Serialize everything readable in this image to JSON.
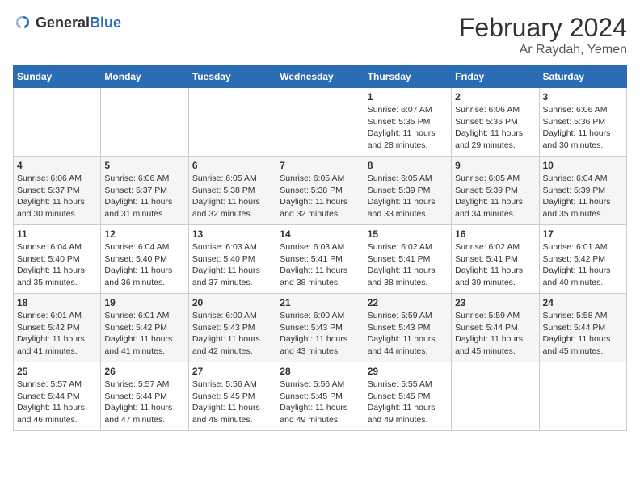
{
  "logo": {
    "general": "General",
    "blue": "Blue"
  },
  "title": "February 2024",
  "subtitle": "Ar Raydah, Yemen",
  "days_of_week": [
    "Sunday",
    "Monday",
    "Tuesday",
    "Wednesday",
    "Thursday",
    "Friday",
    "Saturday"
  ],
  "weeks": [
    [
      {
        "day": "",
        "sunrise": "",
        "sunset": "",
        "daylight": ""
      },
      {
        "day": "",
        "sunrise": "",
        "sunset": "",
        "daylight": ""
      },
      {
        "day": "",
        "sunrise": "",
        "sunset": "",
        "daylight": ""
      },
      {
        "day": "",
        "sunrise": "",
        "sunset": "",
        "daylight": ""
      },
      {
        "day": "1",
        "sunrise": "Sunrise: 6:07 AM",
        "sunset": "Sunset: 5:35 PM",
        "daylight": "Daylight: 11 hours and 28 minutes."
      },
      {
        "day": "2",
        "sunrise": "Sunrise: 6:06 AM",
        "sunset": "Sunset: 5:36 PM",
        "daylight": "Daylight: 11 hours and 29 minutes."
      },
      {
        "day": "3",
        "sunrise": "Sunrise: 6:06 AM",
        "sunset": "Sunset: 5:36 PM",
        "daylight": "Daylight: 11 hours and 30 minutes."
      }
    ],
    [
      {
        "day": "4",
        "sunrise": "Sunrise: 6:06 AM",
        "sunset": "Sunset: 5:37 PM",
        "daylight": "Daylight: 11 hours and 30 minutes."
      },
      {
        "day": "5",
        "sunrise": "Sunrise: 6:06 AM",
        "sunset": "Sunset: 5:37 PM",
        "daylight": "Daylight: 11 hours and 31 minutes."
      },
      {
        "day": "6",
        "sunrise": "Sunrise: 6:05 AM",
        "sunset": "Sunset: 5:38 PM",
        "daylight": "Daylight: 11 hours and 32 minutes."
      },
      {
        "day": "7",
        "sunrise": "Sunrise: 6:05 AM",
        "sunset": "Sunset: 5:38 PM",
        "daylight": "Daylight: 11 hours and 32 minutes."
      },
      {
        "day": "8",
        "sunrise": "Sunrise: 6:05 AM",
        "sunset": "Sunset: 5:39 PM",
        "daylight": "Daylight: 11 hours and 33 minutes."
      },
      {
        "day": "9",
        "sunrise": "Sunrise: 6:05 AM",
        "sunset": "Sunset: 5:39 PM",
        "daylight": "Daylight: 11 hours and 34 minutes."
      },
      {
        "day": "10",
        "sunrise": "Sunrise: 6:04 AM",
        "sunset": "Sunset: 5:39 PM",
        "daylight": "Daylight: 11 hours and 35 minutes."
      }
    ],
    [
      {
        "day": "11",
        "sunrise": "Sunrise: 6:04 AM",
        "sunset": "Sunset: 5:40 PM",
        "daylight": "Daylight: 11 hours and 35 minutes."
      },
      {
        "day": "12",
        "sunrise": "Sunrise: 6:04 AM",
        "sunset": "Sunset: 5:40 PM",
        "daylight": "Daylight: 11 hours and 36 minutes."
      },
      {
        "day": "13",
        "sunrise": "Sunrise: 6:03 AM",
        "sunset": "Sunset: 5:40 PM",
        "daylight": "Daylight: 11 hours and 37 minutes."
      },
      {
        "day": "14",
        "sunrise": "Sunrise: 6:03 AM",
        "sunset": "Sunset: 5:41 PM",
        "daylight": "Daylight: 11 hours and 38 minutes."
      },
      {
        "day": "15",
        "sunrise": "Sunrise: 6:02 AM",
        "sunset": "Sunset: 5:41 PM",
        "daylight": "Daylight: 11 hours and 38 minutes."
      },
      {
        "day": "16",
        "sunrise": "Sunrise: 6:02 AM",
        "sunset": "Sunset: 5:41 PM",
        "daylight": "Daylight: 11 hours and 39 minutes."
      },
      {
        "day": "17",
        "sunrise": "Sunrise: 6:01 AM",
        "sunset": "Sunset: 5:42 PM",
        "daylight": "Daylight: 11 hours and 40 minutes."
      }
    ],
    [
      {
        "day": "18",
        "sunrise": "Sunrise: 6:01 AM",
        "sunset": "Sunset: 5:42 PM",
        "daylight": "Daylight: 11 hours and 41 minutes."
      },
      {
        "day": "19",
        "sunrise": "Sunrise: 6:01 AM",
        "sunset": "Sunset: 5:42 PM",
        "daylight": "Daylight: 11 hours and 41 minutes."
      },
      {
        "day": "20",
        "sunrise": "Sunrise: 6:00 AM",
        "sunset": "Sunset: 5:43 PM",
        "daylight": "Daylight: 11 hours and 42 minutes."
      },
      {
        "day": "21",
        "sunrise": "Sunrise: 6:00 AM",
        "sunset": "Sunset: 5:43 PM",
        "daylight": "Daylight: 11 hours and 43 minutes."
      },
      {
        "day": "22",
        "sunrise": "Sunrise: 5:59 AM",
        "sunset": "Sunset: 5:43 PM",
        "daylight": "Daylight: 11 hours and 44 minutes."
      },
      {
        "day": "23",
        "sunrise": "Sunrise: 5:59 AM",
        "sunset": "Sunset: 5:44 PM",
        "daylight": "Daylight: 11 hours and 45 minutes."
      },
      {
        "day": "24",
        "sunrise": "Sunrise: 5:58 AM",
        "sunset": "Sunset: 5:44 PM",
        "daylight": "Daylight: 11 hours and 45 minutes."
      }
    ],
    [
      {
        "day": "25",
        "sunrise": "Sunrise: 5:57 AM",
        "sunset": "Sunset: 5:44 PM",
        "daylight": "Daylight: 11 hours and 46 minutes."
      },
      {
        "day": "26",
        "sunrise": "Sunrise: 5:57 AM",
        "sunset": "Sunset: 5:44 PM",
        "daylight": "Daylight: 11 hours and 47 minutes."
      },
      {
        "day": "27",
        "sunrise": "Sunrise: 5:56 AM",
        "sunset": "Sunset: 5:45 PM",
        "daylight": "Daylight: 11 hours and 48 minutes."
      },
      {
        "day": "28",
        "sunrise": "Sunrise: 5:56 AM",
        "sunset": "Sunset: 5:45 PM",
        "daylight": "Daylight: 11 hours and 49 minutes."
      },
      {
        "day": "29",
        "sunrise": "Sunrise: 5:55 AM",
        "sunset": "Sunset: 5:45 PM",
        "daylight": "Daylight: 11 hours and 49 minutes."
      },
      {
        "day": "",
        "sunrise": "",
        "sunset": "",
        "daylight": ""
      },
      {
        "day": "",
        "sunrise": "",
        "sunset": "",
        "daylight": ""
      }
    ]
  ]
}
